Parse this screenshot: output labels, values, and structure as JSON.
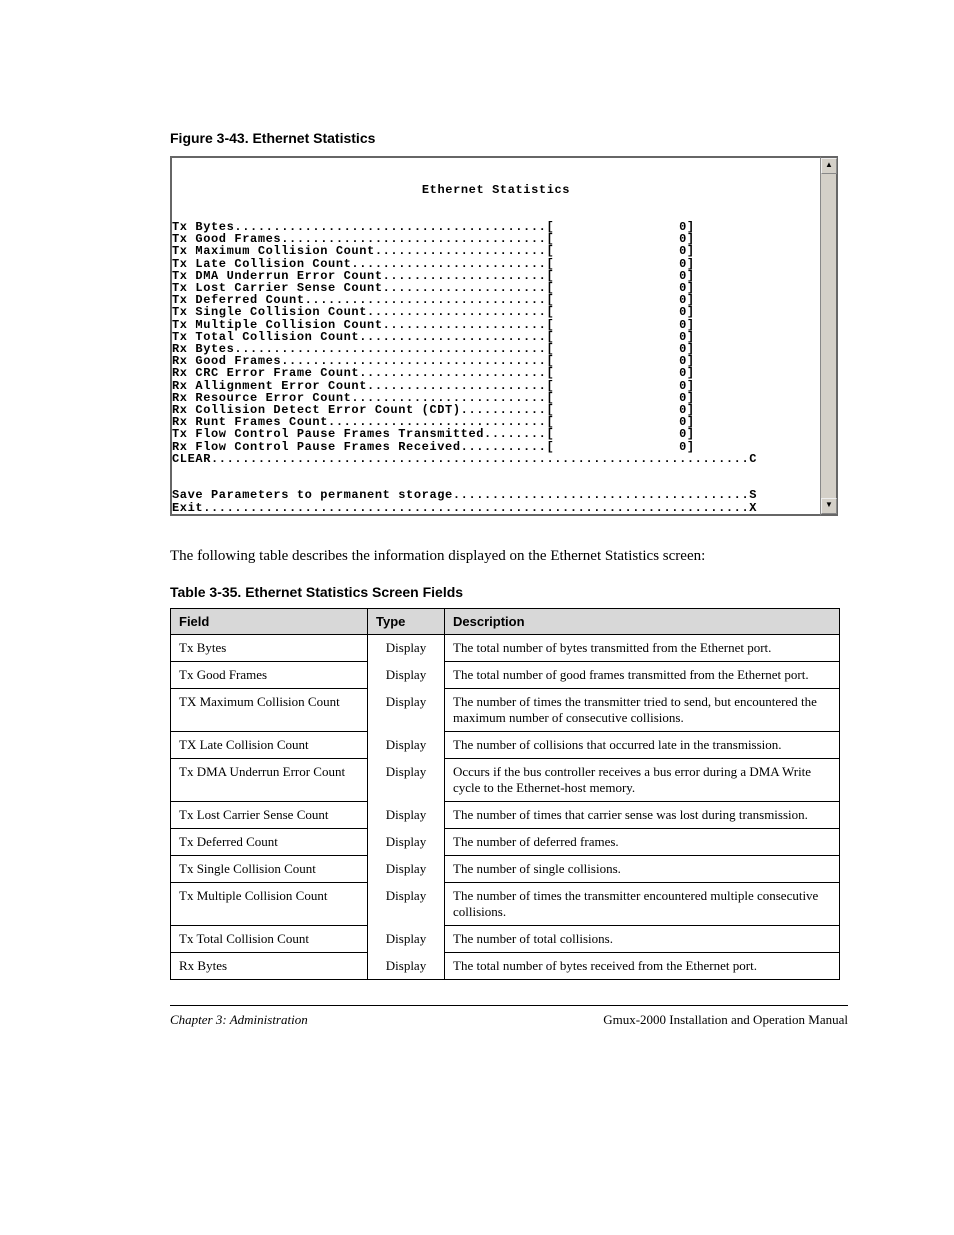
{
  "figure_caption": "Figure 3-43. Ethernet Statistics",
  "terminal": {
    "title": "Ethernet Statistics",
    "stats": [
      {
        "label": "Tx Bytes",
        "value": "0"
      },
      {
        "label": "Tx Good Frames",
        "value": "0"
      },
      {
        "label": "Tx Maximum Collision Count",
        "value": "0"
      },
      {
        "label": "Tx Late Collision Count",
        "value": "0"
      },
      {
        "label": "Tx DMA Underrun Error Count",
        "value": "0"
      },
      {
        "label": "Tx Lost Carrier Sense Count",
        "value": "0"
      },
      {
        "label": "Tx Deferred Count",
        "value": "0"
      },
      {
        "label": "Tx Single Collision Count",
        "value": "0"
      },
      {
        "label": "Tx Multiple Collision Count",
        "value": "0"
      },
      {
        "label": "Tx Total Collision Count",
        "value": "0"
      },
      {
        "label": "Rx Bytes",
        "value": "0"
      },
      {
        "label": "Rx Good Frames",
        "value": "0"
      },
      {
        "label": "Rx CRC Error Frame Count",
        "value": "0"
      },
      {
        "label": "Rx Allignment Error Count",
        "value": "0"
      },
      {
        "label": "Rx Resource Error Count",
        "value": "0"
      },
      {
        "label": "Rx Collision Detect Error Count (CDT)",
        "value": "0"
      },
      {
        "label": "Rx Runt Frames Count",
        "value": "0"
      },
      {
        "label": "Tx Flow Control Pause Frames Transmitted",
        "value": "0"
      },
      {
        "label": "Rx Flow Control Pause Frames Received",
        "value": "0"
      }
    ],
    "commands": [
      {
        "label": "CLEAR",
        "key": "C"
      },
      {
        "label": "",
        "key": ""
      },
      {
        "label": "",
        "key": ""
      },
      {
        "label": "Save Parameters to permanent storage",
        "key": "S"
      },
      {
        "label": "Exit",
        "key": "X"
      }
    ]
  },
  "intro_text": "The following table describes the information displayed on the Ethernet Statistics screen:",
  "table_caption": "Table 3-35. Ethernet Statistics Screen Fields",
  "table": {
    "headers": [
      "Field",
      "Type",
      "Description"
    ],
    "rows": [
      [
        "Tx Bytes",
        "Display",
        "The total number of bytes transmitted from the Ethernet port."
      ],
      [
        "Tx Good Frames",
        "Display",
        "The total number of good frames transmitted from the Ethernet port."
      ],
      [
        "TX Maximum Collision Count",
        "Display",
        "The number of times the transmitter tried to send, but encountered the maximum number of consecutive collisions."
      ],
      [
        "TX Late Collision Count",
        "Display",
        "The number of collisions that occurred late in the transmission."
      ],
      [
        "Tx DMA Underrun Error Count",
        "Display",
        "Occurs if the bus controller receives a bus error during a DMA Write cycle to the Ethernet-host memory."
      ],
      [
        "Tx Lost Carrier Sense Count",
        "Display",
        "The number of times that carrier sense was lost during transmission."
      ],
      [
        "Tx Deferred Count",
        "Display",
        "The number of deferred frames."
      ],
      [
        "Tx Single Collision Count",
        "Display",
        "The number of single collisions."
      ],
      [
        "Tx Multiple Collision Count",
        "Display",
        "The number of times the transmitter encountered multiple consecutive collisions."
      ],
      [
        "Tx Total Collision Count",
        "Display",
        "The number of total collisions."
      ],
      [
        "Rx Bytes",
        "Display",
        "The total number of bytes received from the Ethernet port."
      ]
    ]
  },
  "footer": {
    "left": "Chapter 3: Administration",
    "right": "Gmux-2000 Installation and Operation Manual"
  }
}
